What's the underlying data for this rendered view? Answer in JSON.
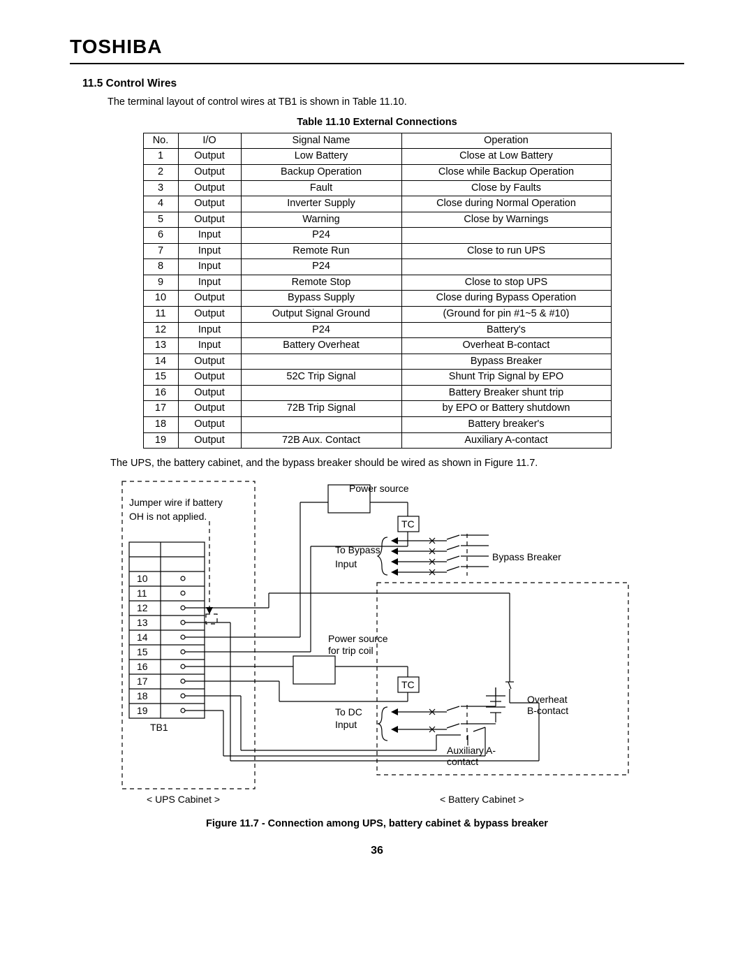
{
  "brand": "TOSHIBA",
  "section": {
    "number": "11.5",
    "title": "Control Wires"
  },
  "intro": "The terminal layout of control wires at TB1 is shown in Table 11.10.",
  "table": {
    "caption": "Table 11.10 External Connections",
    "headers": {
      "no": "No.",
      "io": "I/O",
      "sig": "Signal Name",
      "op": "Operation"
    },
    "rows": [
      {
        "no": "1",
        "io": "Output",
        "sig": "Low Battery",
        "op": "Close at Low Battery",
        "border": "solid"
      },
      {
        "no": "2",
        "io": "Output",
        "sig": "Backup Operation",
        "op": "Close while Backup Operation",
        "border": "solid"
      },
      {
        "no": "3",
        "io": "Output",
        "sig": "Fault",
        "op": "Close by Faults",
        "border": "solid"
      },
      {
        "no": "4",
        "io": "Output",
        "sig": "Inverter Supply",
        "op": "Close during Normal Operation",
        "border": "solid"
      },
      {
        "no": "5",
        "io": "Output",
        "sig": "Warning",
        "op": "Close by Warnings",
        "border": "solid"
      },
      {
        "no": "6",
        "io": "Input",
        "sig": "P24",
        "op": "",
        "border": "dashed"
      },
      {
        "no": "7",
        "io": "Input",
        "sig": "Remote Run",
        "op": "Close to run UPS",
        "border": "solid"
      },
      {
        "no": "8",
        "io": "Input",
        "sig": "P24",
        "op": "",
        "border": "dashed"
      },
      {
        "no": "9",
        "io": "Input",
        "sig": "Remote Stop",
        "op": "Close to stop UPS",
        "border": "solid"
      },
      {
        "no": "10",
        "io": "Output",
        "sig": "Bypass Supply",
        "op": "Close during Bypass Operation",
        "border": "solid"
      },
      {
        "no": "11",
        "io": "Output",
        "sig": "Output Signal Ground",
        "op": "(Ground for pin #1~5 & #10)",
        "border": "solid"
      },
      {
        "no": "12",
        "io": "Input",
        "sig": "P24",
        "op": "Battery's",
        "border": "dashed"
      },
      {
        "no": "13",
        "io": "Input",
        "sig": "Battery Overheat",
        "op": "Overheat B-contact",
        "border": "solid"
      },
      {
        "no": "14",
        "io": "Output",
        "sig": "",
        "op": "Bypass Breaker",
        "border": "dashed"
      },
      {
        "no": "15",
        "io": "Output",
        "sig": "52C Trip Signal",
        "op": "Shunt Trip Signal by EPO",
        "border": "solid"
      },
      {
        "no": "16",
        "io": "Output",
        "sig": "",
        "op": "Battery Breaker shunt trip",
        "border": "dashed"
      },
      {
        "no": "17",
        "io": "Output",
        "sig": "72B Trip Signal",
        "op": "by EPO or Battery shutdown",
        "border": "solid"
      },
      {
        "no": "18",
        "io": "Output",
        "sig": "",
        "op": "Battery breaker's",
        "border": "dashed"
      },
      {
        "no": "19",
        "io": "Output",
        "sig": "72B Aux. Contact",
        "op": "Auxiliary A-contact",
        "border": "solid"
      }
    ]
  },
  "para2": "The UPS, the battery cabinet, and the bypass breaker should be wired as shown in Figure 11.7.",
  "figure": {
    "caption": "Figure 11.7 - Connection among UPS, battery cabinet & bypass breaker",
    "labels": {
      "jumper1": "Jumper wire if battery",
      "jumper2": "OH is not applied.",
      "power_source": "Power source",
      "tc": "TC",
      "to_bypass": "To Bypass",
      "input": "Input",
      "bypass_breaker": "Bypass Breaker",
      "power_source_trip1": "Power source",
      "power_source_trip2": "for trip coil",
      "to_dc": "To DC",
      "overheat1": "Overheat",
      "overheat2": "B-contact",
      "aux1": "Auxiliary A-",
      "aux2": "contact",
      "tb1": "TB1",
      "ups_cabinet": "< UPS Cabinet >",
      "battery_cabinet": "< Battery Cabinet >",
      "t10": "10",
      "t11": "11",
      "t12": "12",
      "t13": "13",
      "t14": "14",
      "t15": "15",
      "t16": "16",
      "t17": "17",
      "t18": "18",
      "t19": "19"
    }
  },
  "page_number": "36"
}
